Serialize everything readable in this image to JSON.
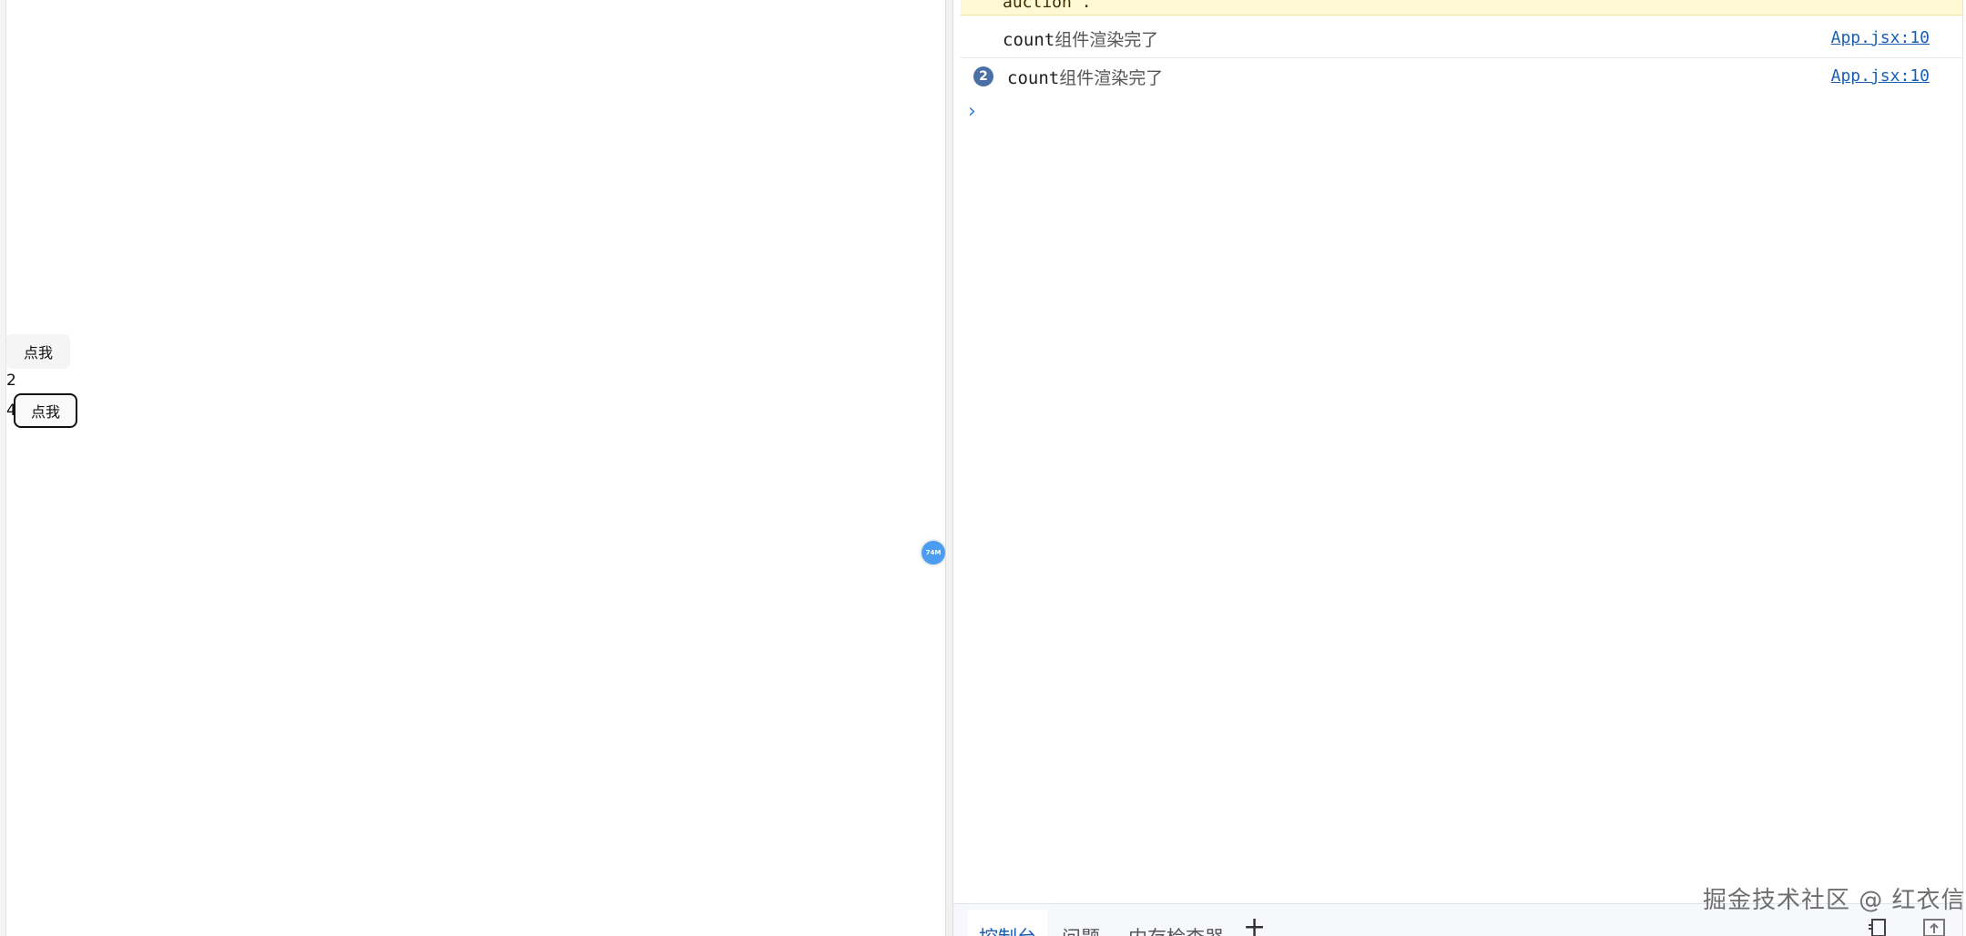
{
  "page": {
    "button_top_label": "点我",
    "count_value_1": "2",
    "count_value_2": "4",
    "button_bottom_label": "点我",
    "floating_badge_text": "74M"
  },
  "console": {
    "warning_tail": "auction`.",
    "logs": [
      {
        "prefix": "count",
        "suffix": "组件渲染完了",
        "source": "App.jsx:10",
        "repeat": ""
      },
      {
        "prefix": "count",
        "suffix": "组件渲染完了",
        "source": "App.jsx:10",
        "repeat": "2"
      }
    ],
    "prompt_glyph": "›"
  },
  "drawer": {
    "tabs": [
      {
        "label": "控制台"
      },
      {
        "label": "问题"
      },
      {
        "label": "内存检查器"
      }
    ],
    "add_tab_glyph": "+"
  },
  "watermark": "掘金技术社区 @ 红衣信",
  "colors": {
    "link": "#1a5fb4",
    "warning_bg": "#fff8d5",
    "badge": "#4a6fa5",
    "float_badge": "#4a9df0"
  }
}
